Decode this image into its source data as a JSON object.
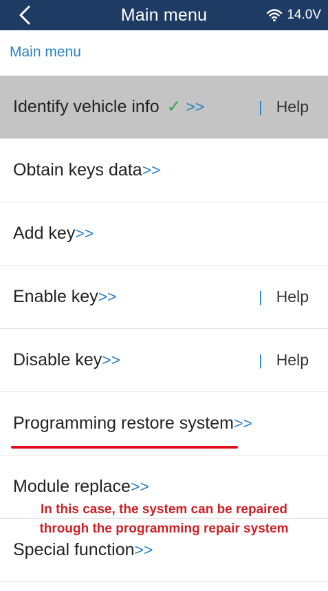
{
  "header": {
    "title": "Main menu",
    "voltage": "14.0V",
    "back_icon": "chevron-left-icon",
    "wifi_icon": "wifi-icon",
    "background": "#1d3b63"
  },
  "breadcrumb": "Main menu",
  "menu": {
    "items": [
      {
        "label": "Identify vehicle info",
        "check": "✓",
        "arrow": ">>",
        "help": "Help",
        "selected": true
      },
      {
        "label": "Obtain keys data",
        "arrow": ">>"
      },
      {
        "label": "Add key",
        "arrow": ">>"
      },
      {
        "label": "Enable key",
        "arrow": ">>",
        "help": "Help"
      },
      {
        "label": "Disable key",
        "arrow": ">>",
        "help": "Help"
      },
      {
        "label": "Programming restore system",
        "arrow": ">>"
      },
      {
        "label": "Module replace",
        "arrow": ">>"
      },
      {
        "label": "Special function",
        "arrow": ">>"
      }
    ],
    "help_separator": "|",
    "arrow_color": "#2a82c9",
    "selected_background": "#c4c4c4"
  },
  "annotation": {
    "line1": "In this case, the system can be repaired",
    "line2": "through the programming repair system",
    "color": "#d21f24"
  }
}
